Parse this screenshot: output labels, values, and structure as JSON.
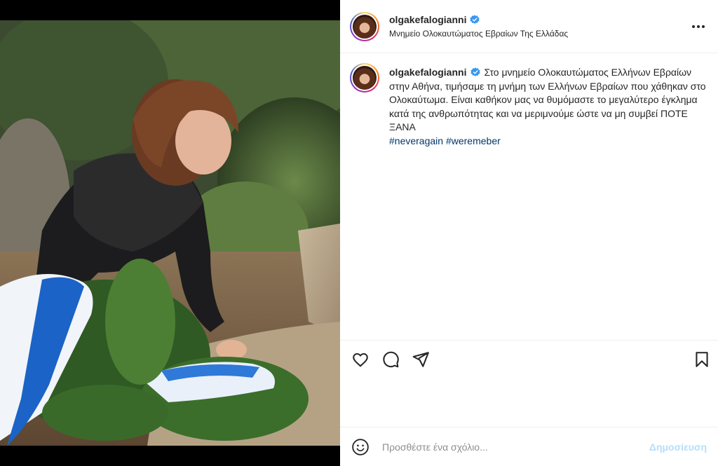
{
  "post": {
    "username": "olgakefalogianni",
    "verified": true,
    "location": "Μνημείο Ολοκαυτώματος Εβραίων Της Ελλάδας",
    "caption": {
      "text": "Στο μνημείο Ολοκαυτώματος Ελλήνων Εβραίων στην Αθήνα, τιμήσαμε τη μνήμη των Ελλήνων Εβραίων που χάθηκαν στο Ολοκαύτωμα. Είναι καθήκον μας να θυμόμαστε το μεγαλύτερο έγκλημα κατά της ανθρωπότητας και να μεριμνούμε ώστε να μη συμβεί ΠΟΤΕ ΞΑΝΑ",
      "hashtags": [
        "#neveragain",
        "#weremeber"
      ]
    }
  },
  "icons": {
    "more": "more-options-icon",
    "like": "heart-icon",
    "comment": "comment-icon",
    "share": "paper-plane-icon",
    "save": "bookmark-icon",
    "emoji": "emoji-icon",
    "verified": "verified-badge-icon"
  },
  "comment": {
    "placeholder": "Προσθέστε ένα σχόλιο...",
    "publish_label": "Δημοσίευση"
  },
  "colors": {
    "link": "#00376b",
    "verified": "#3897f0",
    "publish_disabled": "#b2dffc",
    "border": "#efefef"
  }
}
